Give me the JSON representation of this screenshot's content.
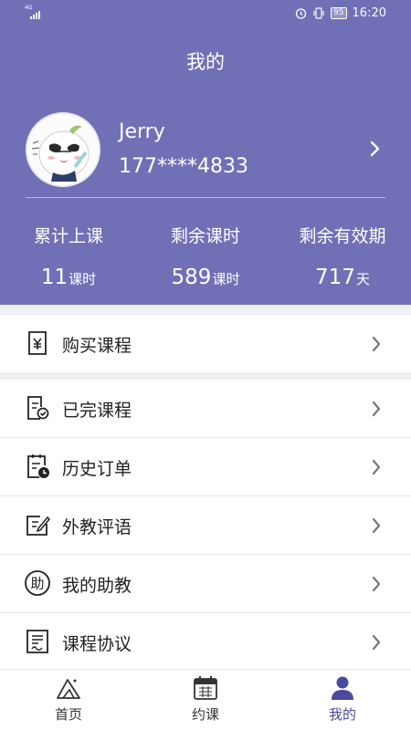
{
  "status_bar": {
    "network": "4G",
    "battery": "95",
    "time": "16:20"
  },
  "header": {
    "title": "我的",
    "background_color": "#7170b6"
  },
  "profile": {
    "name": "Jerry",
    "phone": "177****4833",
    "avatar_icon": "cartoon-avatar"
  },
  "stats": [
    {
      "label": "累计上课",
      "value": "11",
      "unit": "课时"
    },
    {
      "label": "剩余课时",
      "value": "589",
      "unit": "课时"
    },
    {
      "label": "剩余有效期",
      "value": "717",
      "unit": "天"
    }
  ],
  "menu": [
    {
      "label": "购买课程",
      "icon": "purchase-yen-icon"
    },
    {
      "label": "已完课程",
      "icon": "completed-courses-icon"
    },
    {
      "label": "历史订单",
      "icon": "order-history-icon"
    },
    {
      "label": "外教评语",
      "icon": "teacher-comment-icon"
    },
    {
      "label": "我的助教",
      "icon": "assistant-icon"
    },
    {
      "label": "课程协议",
      "icon": "agreement-icon"
    }
  ],
  "tabbar": {
    "items": [
      {
        "label": "首页",
        "icon": "home-mountain-icon",
        "active": false
      },
      {
        "label": "约课",
        "icon": "calendar-icon",
        "active": false
      },
      {
        "label": "我的",
        "icon": "user-icon",
        "active": true
      }
    ],
    "active_color": "#4b4a9c"
  }
}
